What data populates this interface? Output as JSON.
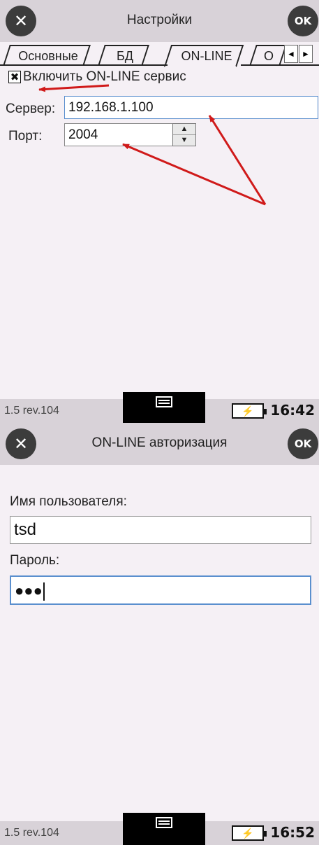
{
  "screen1": {
    "title": "Настройки",
    "close_icon": "close-icon",
    "ok_label": "OK",
    "tabs": [
      "Основные",
      "БД",
      "ON-LINE",
      "О"
    ],
    "active_tab": "ON-LINE",
    "tab_scroll_left": "◄",
    "tab_scroll_right": "►",
    "online_checkbox": {
      "label": "Включить ON-LINE сервис",
      "checked": true,
      "mark": "✖"
    },
    "server": {
      "label": "Сервер:",
      "value": "192.168.1.100"
    },
    "port": {
      "label": "Порт:",
      "value": "2004",
      "up": "▲",
      "down": "▼"
    },
    "status": {
      "version": "1.5 rev.104",
      "battery": "⚡",
      "time": "16:42"
    }
  },
  "screen2": {
    "title": "ON-LINE авторизация",
    "ok_label": "OK",
    "username": {
      "label": "Имя пользователя:",
      "value": "tsd"
    },
    "password": {
      "label": "Пароль:",
      "value": "●●●"
    },
    "status": {
      "version": "1.5 rev.104",
      "battery": "⚡",
      "time": "16:52"
    }
  },
  "colors": {
    "arrow": "#d01a1a",
    "focus_border": "#5a8fce",
    "title_bg": "#d8d2d8",
    "page_bg": "#f5f0f5"
  }
}
